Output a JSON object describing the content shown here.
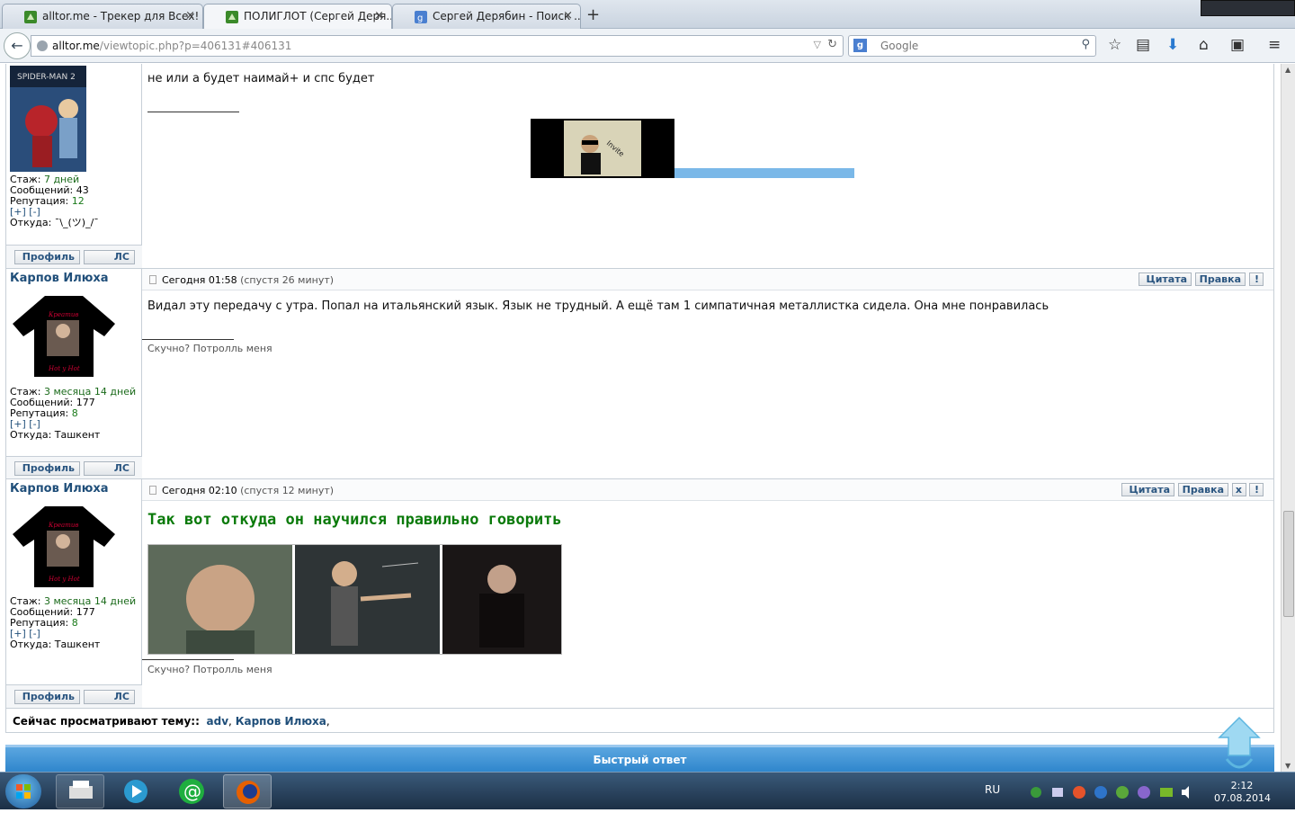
{
  "browser": {
    "tabs": [
      {
        "label": "alltor.me - Трекер для Всех!",
        "active": false
      },
      {
        "label": "ПОЛИГЛОТ (Сергей Деря...",
        "active": true
      },
      {
        "label": "Сергей Дерябин - Поиск ...",
        "active": false
      }
    ],
    "url_host": "alltor.me",
    "url_path": "/viewtopic.php?p=406131#406131",
    "search_placeholder": "Google"
  },
  "posts": [
    {
      "author": "",
      "stats": {
        "stazh_label": "Стаж:",
        "stazh": "7 дней",
        "msgs_label": "Сообщений:",
        "msgs": "43",
        "rep_label": "Репутация:",
        "rep": "12",
        "plusminus": "[+] [-]",
        "from_label": "Откуда:",
        "from": "¯\\_(ツ)_/¯"
      },
      "text": "не или а будет наимай+ и спс будет",
      "profile_label": "Профиль",
      "pm_label": "ЛС"
    },
    {
      "author": "Карпов Илюха",
      "date": "Сегодня 01:58",
      "ago": "(спустя 26 минут)",
      "stats": {
        "stazh_label": "Стаж:",
        "stazh": "3 месяца 14 дней",
        "msgs_label": "Сообщений:",
        "msgs": "177",
        "rep_label": "Репутация:",
        "rep": "8",
        "plusminus": "[+] [-]",
        "from_label": "Откуда:",
        "from": "Ташкент"
      },
      "text": "Видал эту передачу с утра. Попал на итальянский язык. Язык не трудный. А ещё там 1 симпатичная металлистка сидела. Она мне понравилась",
      "signature": "Скучно? Потролль меня",
      "quote_label": "Цитата",
      "edit_label": "Правка",
      "report_label": "!",
      "profile_label": "Профиль",
      "pm_label": "ЛС"
    },
    {
      "author": "Карпов Илюха",
      "date": "Сегодня 02:10",
      "ago": "(спустя 12 минут)",
      "stats": {
        "stazh_label": "Стаж:",
        "stazh": "3 месяца 14 дней",
        "msgs_label": "Сообщений:",
        "msgs": "177",
        "rep_label": "Репутация:",
        "rep": "8",
        "plusminus": "[+] [-]",
        "from_label": "Откуда:",
        "from": "Ташкент"
      },
      "text": "Так вот откуда он научился правильно говорить",
      "signature": "Скучно? Потролль меня",
      "quote_label": "Цитата",
      "edit_label": "Правка",
      "delete_label": "x",
      "report_label": "!",
      "profile_label": "Профиль",
      "pm_label": "ЛС"
    }
  ],
  "viewing": {
    "label": "Сейчас просматривают тему::",
    "users": [
      "adv",
      "Карпов Илюха"
    ]
  },
  "quick_reply": "Быстрый ответ",
  "taskbar": {
    "lang": "RU",
    "time": "2:12",
    "date": "07.08.2014"
  }
}
